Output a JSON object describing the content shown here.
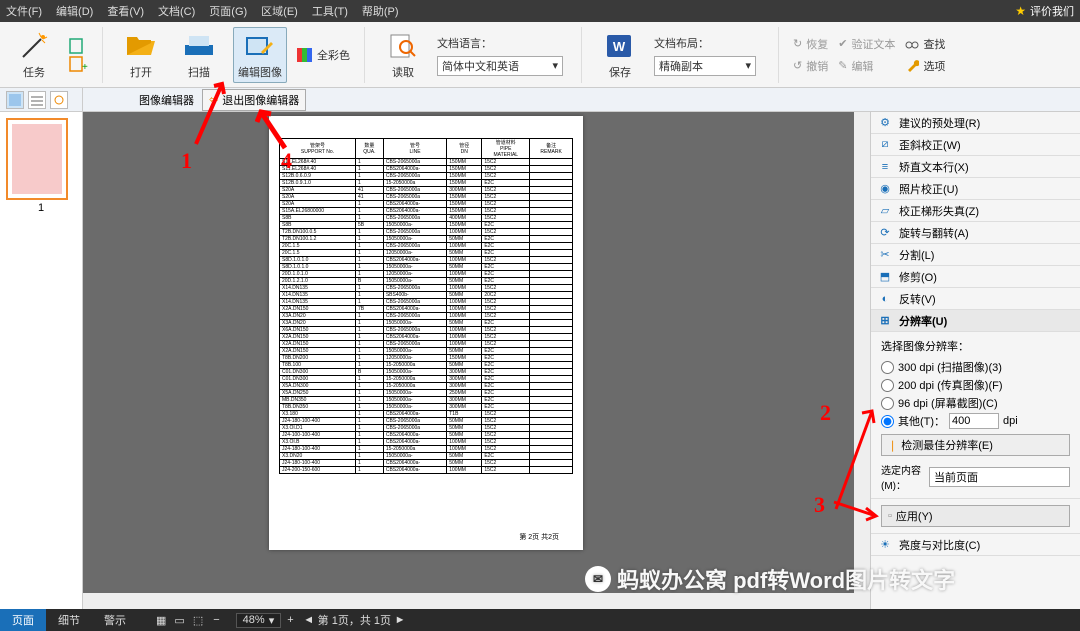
{
  "menu": {
    "items": [
      "文件(F)",
      "编辑(D)",
      "查看(V)",
      "文档(C)",
      "页面(G)",
      "区域(E)",
      "工具(T)",
      "帮助(P)"
    ],
    "rate": "评价我们"
  },
  "ribbon": {
    "task": "任务",
    "open": "打开",
    "scan": "扫描",
    "editimg": "编辑图像",
    "fullcolor": "全彩色",
    "read": "读取",
    "doclang_label": "文档语言：",
    "doclang_value": "简体中文和英语",
    "save": "保存",
    "layout_label": "文档布局：",
    "layout_value": "精确副本",
    "restore": "恢复",
    "undo": "撤销",
    "verify": "验证文本",
    "edit": "编辑",
    "find": "查找",
    "options": "选项"
  },
  "subbar": {
    "editor": "图像编辑器",
    "exit": "退出图像编辑器"
  },
  "thumb": {
    "num": "1"
  },
  "doc": {
    "headers": [
      "管架号\nSUPPORT No.",
      "数量\nQUA.",
      "管号\nLINE",
      "管径\nDN",
      "管道材料\nPIPE\nMATERIAL",
      "备注\nREMARK"
    ],
    "rows": [
      [
        "S11.EL268#.40",
        "1",
        "CBS-2065000a",
        "150MM",
        "15C2",
        ""
      ],
      [
        "S11.EL268#.40",
        "1",
        "CBS2064000a-",
        "150MM",
        "15C2",
        ""
      ],
      [
        "S12B.0.6.0.9",
        "1",
        "CBS-2065000a",
        "150MM",
        "15C2",
        ""
      ],
      [
        "S12B.0.9.1.0",
        "1",
        "15-2050000a",
        "150MM",
        "E2C",
        ""
      ],
      [
        "S20A",
        "41",
        "CBS-2065000a",
        "300MM",
        "15C2",
        ""
      ],
      [
        "S20A",
        "41",
        "CBS-2065000a",
        "150MM",
        "15C2",
        ""
      ],
      [
        "S20A",
        "1",
        "CBS2064000a-",
        "150MM",
        "15C2",
        ""
      ],
      [
        "S15A.EL26800000",
        "1",
        "CBS2064000a-",
        "150MM",
        "15C2",
        ""
      ],
      [
        "S8B",
        "1",
        "CBS-2065000a",
        "400MM",
        "15C2",
        ""
      ],
      [
        "S8B",
        "5B",
        "15050000a-",
        "150MM",
        "E2C",
        ""
      ],
      [
        "T2B.DN100.0.5",
        "1",
        "CBS-2065000a",
        "100MM",
        "15C2",
        ""
      ],
      [
        "T2B.DN100.1.2",
        "1",
        "15050000a-",
        "50MM",
        "E2C",
        ""
      ],
      [
        "20C.1.5",
        "1",
        "CBS-2065000a",
        "100MM",
        "E2C",
        ""
      ],
      [
        "20C.1.5",
        "1",
        "12050000a-",
        "50MM",
        "E2C",
        ""
      ],
      [
        "S8D.1.0.1.0",
        "1",
        "CBS2064000a-",
        "100MM",
        "15C2",
        ""
      ],
      [
        "S8D.1.0.1.0",
        "1",
        "15050000a-",
        "50MM",
        "E2C",
        ""
      ],
      [
        "20D.1.0.1.0",
        "1",
        "12050000a-",
        "100MM",
        "E2C",
        ""
      ],
      [
        "20D.1.2.1.0",
        "B",
        "15050000a-",
        "50MM",
        "E2C",
        ""
      ],
      [
        "X14.DN135",
        "1",
        "CBS-2065000a",
        "100MM",
        "15C2",
        ""
      ],
      [
        "X14.DN135",
        "1",
        "SBS400b-",
        "50MM",
        "20C2",
        ""
      ],
      [
        "X14.DN135",
        "1",
        "CBS-2065000a",
        "100MM",
        "15C2",
        ""
      ],
      [
        "X2A.DN150",
        "7B",
        "CBS2064000a-",
        "100MM",
        "15C2",
        ""
      ],
      [
        "X3A.DN20",
        "1",
        "CBS-2065000a",
        "100MM",
        "15C2",
        ""
      ],
      [
        "X3A.DN20",
        "1",
        "15050000a-",
        "50MM",
        "E2C",
        ""
      ],
      [
        "X6A.DN150",
        "1",
        "CBS-2065000a",
        "100MM",
        "15C2",
        ""
      ],
      [
        "X2A.DN150",
        "1",
        "CBS2064000a-",
        "100MM",
        "15C2",
        ""
      ],
      [
        "X2A.DN150",
        "1",
        "CBS-2065000a",
        "100MM",
        "15C2",
        ""
      ],
      [
        "X2A.DN150",
        "1",
        "15050000a-",
        "50MM",
        "E2C",
        ""
      ],
      [
        "T8B.DN200",
        "1",
        "12050000a-",
        "150MM",
        "E2C",
        ""
      ],
      [
        "T8B.100",
        "1",
        "15-2050000a",
        "50MM",
        "E2C",
        ""
      ],
      [
        "C01.DN300",
        "B",
        "15050000a-",
        "300MM",
        "E2C",
        ""
      ],
      [
        "C01.DN300",
        "1",
        "15-2050000a",
        "300MM",
        "E2C",
        ""
      ],
      [
        "X5A.DN300",
        "1",
        "15-2050000a",
        "300MM",
        "E2C",
        ""
      ],
      [
        "X5A.DN250",
        "1",
        "15050000a-",
        "250MM",
        "E2C",
        ""
      ],
      [
        "MB.DN350",
        "1",
        "15050000a-",
        "300MM",
        "E2C",
        ""
      ],
      [
        "T8B.DN350",
        "1",
        "15050000a-",
        "300MM",
        "E2C",
        ""
      ],
      [
        "X3.180",
        "1",
        "CBS2064000a-",
        "T1B",
        "15C2",
        ""
      ],
      [
        "J24-180-100-400",
        "1",
        "CBS-2065000a",
        "50MM",
        "15C2",
        ""
      ],
      [
        "X3.OI.D1",
        "1",
        "CBS-2065000a",
        "50MM",
        "15C2",
        ""
      ],
      [
        "J24-100-100-400",
        "1",
        "CBS2064000a-",
        "50MM",
        "15C2",
        ""
      ],
      [
        "X3.OI.B",
        "1",
        "CBS2064000a-",
        "100MM",
        "15C2",
        ""
      ],
      [
        "J24-180-100-400",
        "1",
        "15-2050000a",
        "100MM",
        "15C2",
        ""
      ],
      [
        "X3.DN20",
        "1",
        "15050000a-",
        "50MM",
        "E2C",
        ""
      ],
      [
        "J24-180-100-400",
        "1",
        "CBS2064000a-",
        "50MM",
        "15C2",
        ""
      ],
      [
        "J24-200-150-600",
        "1",
        "CBS2064000a-",
        "100MM",
        "15C2",
        ""
      ]
    ],
    "footer": "第 2页 共2页"
  },
  "rightpanel": {
    "items": [
      {
        "label": "建议的预处理(R)"
      },
      {
        "label": "歪斜校正(W)"
      },
      {
        "label": "矫直文本行(X)"
      },
      {
        "label": "照片校正(U)"
      },
      {
        "label": "校正梯形失真(Z)"
      },
      {
        "label": "旋转与翻转(A)"
      },
      {
        "label": "分割(L)"
      },
      {
        "label": "修剪(O)"
      },
      {
        "label": "反转(V)"
      },
      {
        "label": "分辨率(U)"
      }
    ],
    "res_title": "选择图像分辨率：",
    "res_300": "300 dpi (扫描图像)(3)",
    "res_200": "200 dpi (传真图像)(F)",
    "res_96": "96 dpi (屏幕截图)(C)",
    "res_other": "其他(T)：",
    "res_other_val": "400",
    "res_unit": "dpi",
    "detect": "检测最佳分辨率(E)",
    "scope_label": "选定内容(M)：",
    "scope_val": "当前页面",
    "apply": "应用(Y)",
    "brightness": "亮度与对比度(C)"
  },
  "status": {
    "page": "页面",
    "detail": "细节",
    "warn": "警示",
    "zoom": "48%",
    "pos": "第 1页，共 1页"
  },
  "watermark": "蚂蚁办公窝 pdf转Word图片转文字",
  "anno": {
    "n1": "1",
    "n2": "2",
    "n3": "3",
    "n4": "4"
  }
}
